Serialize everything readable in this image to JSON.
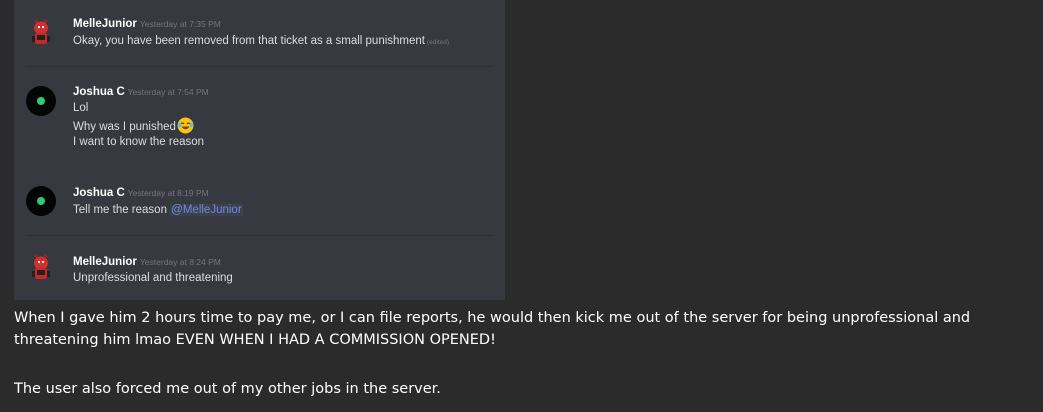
{
  "screenshot": {
    "messages": [
      {
        "author": "MelleJunior",
        "timestamp": "Yesterday at 7:35 PM",
        "lines": [
          "Okay, you have been removed from that ticket as a small punishment"
        ],
        "edited_label": "(edited)"
      },
      {
        "author": "Joshua C",
        "timestamp": "Yesterday at 7:54 PM",
        "lines": [
          "Lol",
          "Why was I punished",
          "I want to know the reason"
        ]
      },
      {
        "author": "Joshua C",
        "timestamp": "Yesterday at 8:19 PM",
        "lines": [
          "Tell me the reason"
        ],
        "mention": "@MelleJunior"
      },
      {
        "author": "MelleJunior",
        "timestamp": "Yesterday at 8:24 PM",
        "lines": [
          "Unprofessional and threatening"
        ]
      }
    ]
  },
  "post": {
    "paragraph1": "When I gave him 2 hours time to pay me, or I can file reports, he would then kick me out of the server for being unprofessional and threatening him lmao EVEN WHEN I HAD A COMMISSION OPENED!",
    "paragraph2": "The user also forced me out of my other jobs in the server."
  },
  "colors": {
    "page_background": "#2b2b2b",
    "discord_background": "#36393f",
    "username": "#ffffff",
    "message_text": "#dcddde",
    "timestamp": "#72767d",
    "mention": "#7289da",
    "online_dot": "#2ecc71"
  },
  "icons": [
    "red-devil-avatar-icon",
    "black-green-dot-avatar-icon",
    "joy-emoji-icon"
  ]
}
